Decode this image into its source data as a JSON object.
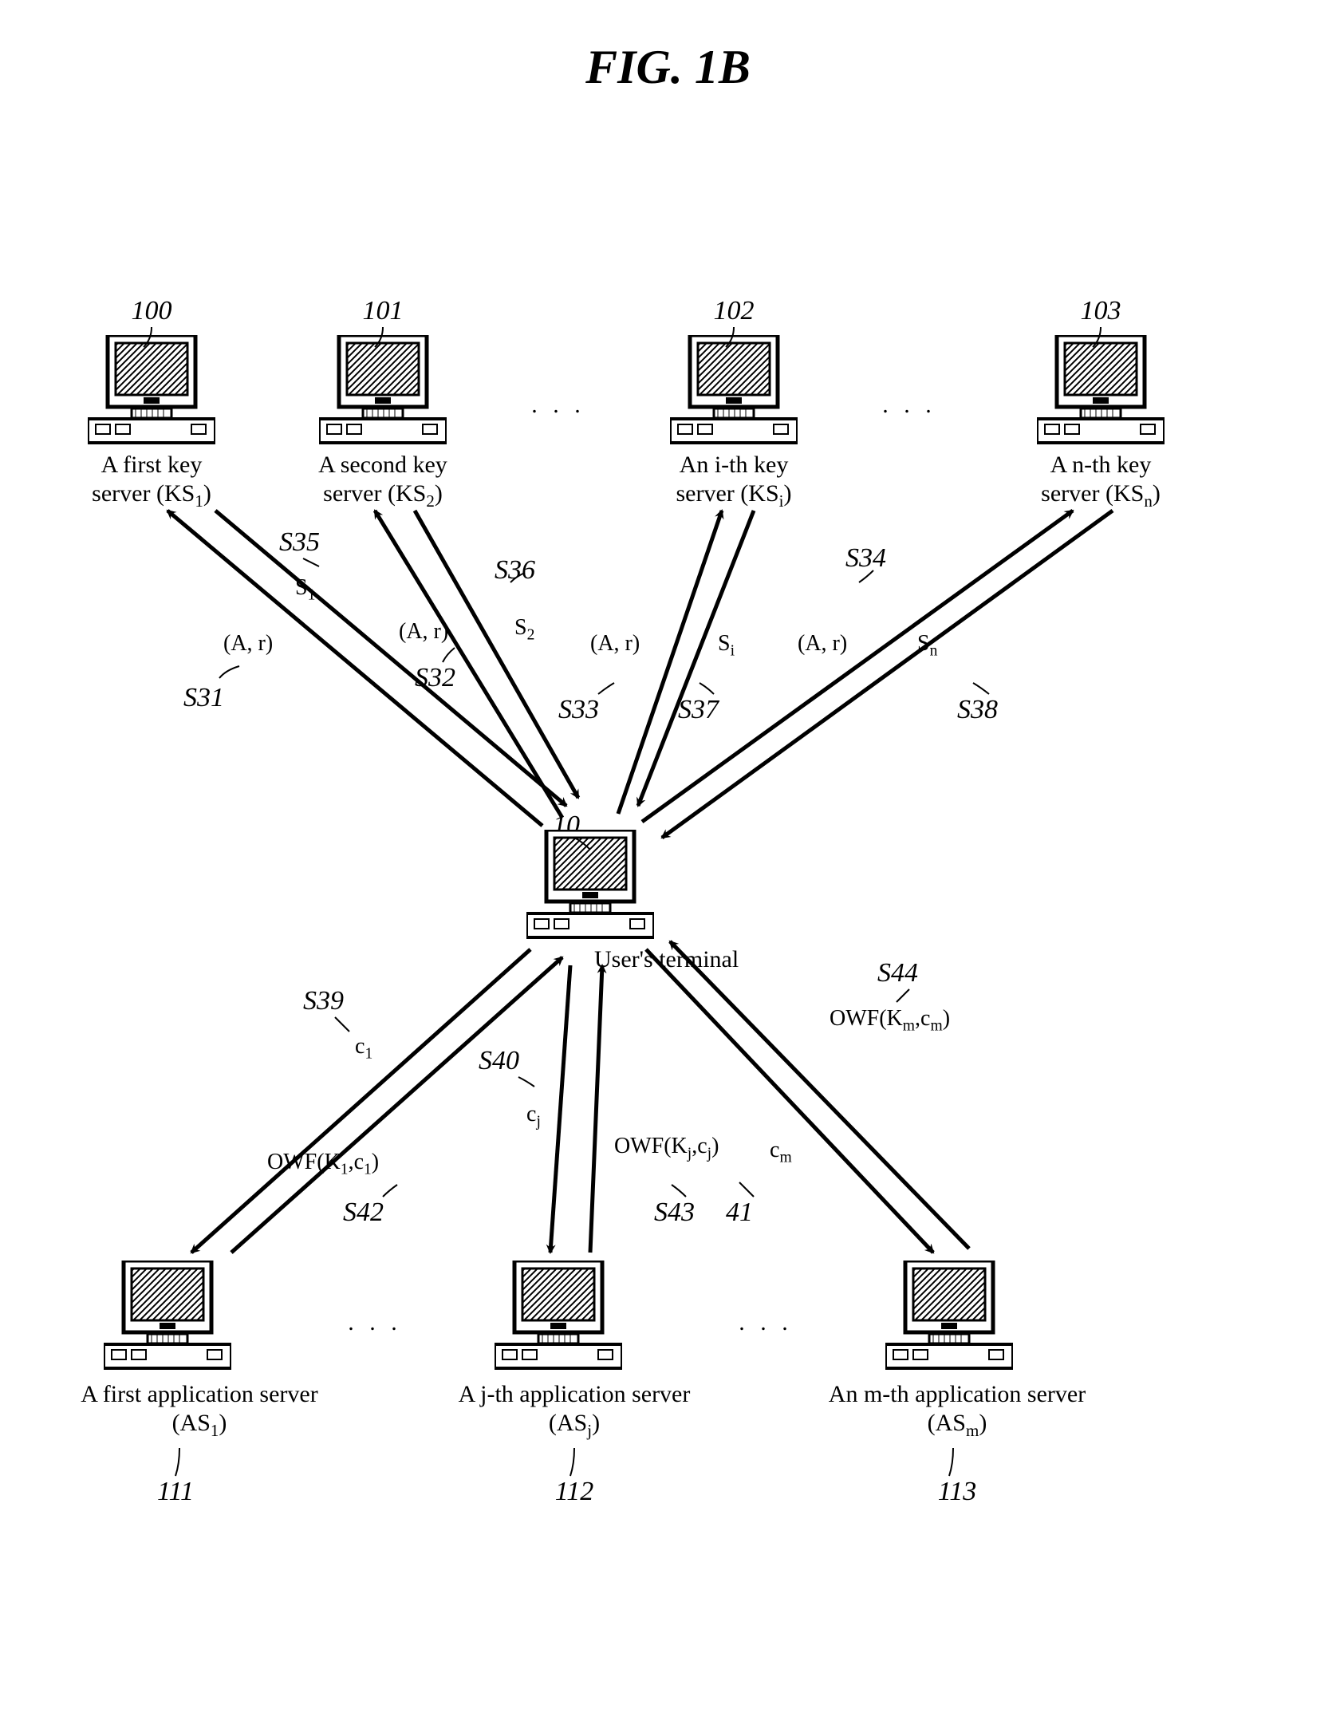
{
  "figure_title": "FIG. 1B",
  "nodes": {
    "ks1": {
      "ref": "100",
      "label_html": "A first key<br>server (KS<sub>1</sub>)"
    },
    "ks2": {
      "ref": "101",
      "label_html": "A second key<br>server (KS<sub>2</sub>)"
    },
    "ksi": {
      "ref": "102",
      "label_html": "An i-th key<br>server (KS<sub>i</sub>)"
    },
    "ksn": {
      "ref": "103",
      "label_html": "A n-th key<br>server (KS<sub>n</sub>)"
    },
    "user": {
      "ref": "10",
      "label_html": "User's terminal"
    },
    "as1": {
      "ref": "111",
      "label_html": "A first application server<br>(AS<sub>1</sub>)"
    },
    "asj": {
      "ref": "112",
      "label_html": "A j-th application server<br>(AS<sub>j</sub>)"
    },
    "asm": {
      "ref": "113",
      "label_html": "An m-th application server<br>(AS<sub>m</sub>)"
    }
  },
  "ellipsis": ". . .",
  "arrows_top": {
    "s31": {
      "step": "S31",
      "msg_html": "(A, r)"
    },
    "s32": {
      "step": "S32",
      "msg_html": "(A, r)"
    },
    "s33": {
      "step": "S33",
      "msg_html": "(A, r)"
    },
    "s34": {
      "step": "S34",
      "msg_html": "(A, r)"
    },
    "s35": {
      "step": "S35",
      "msg_html": "S<sub>1</sub>"
    },
    "s36": {
      "step": "S36",
      "msg_html": "S<sub>2</sub>"
    },
    "s37": {
      "step": "S37",
      "msg_html": "S<sub>i</sub>"
    },
    "s38": {
      "step": "S38",
      "msg_html": "S<sub>n</sub>"
    }
  },
  "arrows_bottom": {
    "s39": {
      "step": "S39",
      "msg_html": "c<sub>1</sub>"
    },
    "s40": {
      "step": "S40",
      "msg_html": "c<sub>j</sub>"
    },
    "s41": {
      "step": "41",
      "msg_html": "c<sub>m</sub>"
    },
    "s42": {
      "step": "S42",
      "msg_html": "OWF(K<sub>1</sub>,c<sub>1</sub>)"
    },
    "s43": {
      "step": "S43",
      "msg_html": "OWF(K<sub>j</sub>,c<sub>j</sub>)"
    },
    "s44": {
      "step": "S44",
      "msg_html": "OWF(K<sub>m</sub>,c<sub>m</sub>)"
    }
  }
}
